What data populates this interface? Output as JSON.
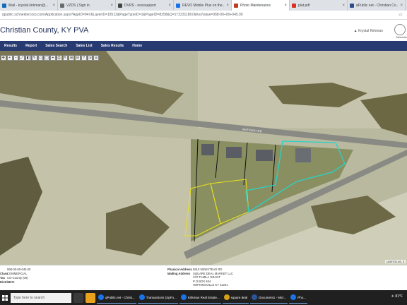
{
  "browser": {
    "tabs": [
      {
        "label": "Mail - krystal.kirkman@...",
        "active": false,
        "color": "#0f6cbd"
      },
      {
        "label": "VZDS | Sign in",
        "active": false,
        "color": "#6b6b6b"
      },
      {
        "label": "DVRS - revosupport",
        "active": false,
        "color": "#444444"
      },
      {
        "label": "REVO Mobile Plus on the...",
        "active": false,
        "color": "#1a73e8"
      },
      {
        "label": "Photo Maintenance",
        "active": true,
        "color": "#c23b22"
      },
      {
        "label": "plat.pdf",
        "active": false,
        "color": "#d93025"
      },
      {
        "label": "qPublic.net - Christian Co...",
        "active": false,
        "color": "#2b4c8c"
      }
    ],
    "url": "qpublic.schneidercorp.com/Application.aspx?AppID=947&LayerID=18512&PageTypeID=1&PageID=8258&Q=1722311867&KeyValue=068-00+00+045.00"
  },
  "site": {
    "title": "Christian County, KY PVA",
    "user": "Krystal Kirkman",
    "logo_text": "Schneider"
  },
  "nav": [
    "Results",
    "Report",
    "Sales Search",
    "Sales List",
    "Sales Results",
    "Home"
  ],
  "map": {
    "road_label": "ANTIOCH RD",
    "scale_text": "1109702.46, 3"
  },
  "parcel": {
    "left": [
      {
        "label": "",
        "value": "068-00-00-045.00"
      },
      {
        "label": "Class",
        "value": "COMMERCIAL"
      },
      {
        "label": "Tax",
        "value": "CO-County (00)"
      },
      {
        "label": "District",
        "value": "1.838"
      },
      {
        "label": "",
        "value": ""
      }
    ],
    "right": [
      {
        "label": "Physical Address",
        "value": "5810 NEWSTEAD RD"
      },
      {
        "label": "Mailing Address",
        "value": "SQUARE DEAL MARKET LLC"
      },
      {
        "label": "",
        "value": "C/O TAMILA GRANT"
      },
      {
        "label": "",
        "value": "P O BOX 404"
      },
      {
        "label": "",
        "value": "HOPKINSVILLE KY 42241"
      }
    ]
  },
  "taskbar": {
    "search_placeholder": "Type here to search",
    "apps": [
      {
        "label": "qPublic.net - Christ...",
        "color": "#1a73e8"
      },
      {
        "label": "Transactions (zipFo...",
        "color": "#1a73e8"
      },
      {
        "label": "Kirkman Real Estate...",
        "color": "#1a73e8"
      },
      {
        "label": "square deal",
        "color": "#d4a017"
      },
      {
        "label": "Document1 - Micr...",
        "color": "#2b579a"
      },
      {
        "label": "Pho...",
        "color": "#1a73e8"
      }
    ],
    "weather": "81°F"
  }
}
